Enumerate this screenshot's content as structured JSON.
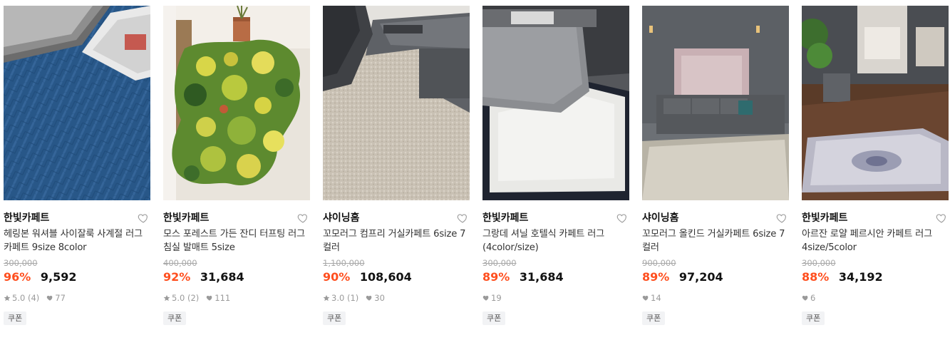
{
  "products": [
    {
      "image": "blue-herringbone-rug-photo",
      "brand": "한빛카페트",
      "title": "헤링본 워셔블 사이잘룩 사계절 러그카페트 9size 8color",
      "original_price": "300,000",
      "discount": "96%",
      "price": "9,592",
      "rating": "5.0",
      "review_count": "(4)",
      "likes": "77",
      "badge": "쿠폰"
    },
    {
      "image": "moss-forest-tufted-rug-photo",
      "brand": "한빛카페트",
      "title": "모스 포레스트 가든 잔디 터프팅 러그 침실 발매트 5size",
      "original_price": "400,000",
      "discount": "92%",
      "price": "31,684",
      "rating": "5.0",
      "review_count": "(2)",
      "likes": "111",
      "badge": "쿠폰"
    },
    {
      "image": "beige-shaggy-rug-photo",
      "brand": "샤이닝홈",
      "title": "꼬모러그 컴프리 거실카페트 6size 7컬러",
      "original_price": "1,100,000",
      "discount": "90%",
      "price": "108,604",
      "rating": "3.0",
      "review_count": "(1)",
      "likes": "30",
      "badge": "쿠폰"
    },
    {
      "image": "white-chenille-hotel-rug-photo",
      "brand": "한빛카페트",
      "title": "그랑데 셔닐 호텔식 카페트 러그 (4color/size)",
      "original_price": "300,000",
      "discount": "89%",
      "price": "31,684",
      "rating": "",
      "review_count": "",
      "likes": "19",
      "badge": "쿠폰"
    },
    {
      "image": "living-room-cream-rug-photo",
      "brand": "샤이닝홈",
      "title": "꼬모러그 올킨드 거실카페트 6size 7컬러",
      "original_price": "900,000",
      "discount": "89%",
      "price": "97,204",
      "rating": "",
      "review_count": "",
      "likes": "14",
      "badge": "쿠폰"
    },
    {
      "image": "persian-royal-rug-photo",
      "brand": "한빛카페트",
      "title": "아르잔 로얄 페르시안 카페트 러그 4size/5color",
      "original_price": "300,000",
      "discount": "88%",
      "price": "34,192",
      "rating": "",
      "review_count": "",
      "likes": "6",
      "badge": "쿠폰"
    }
  ],
  "icons": {
    "wishlist": "heart-outline-icon",
    "rating": "star-icon",
    "likes": "heart-filled-icon"
  },
  "colors": {
    "discount": "#ff4f1f",
    "muted": "#9a9a9a"
  }
}
